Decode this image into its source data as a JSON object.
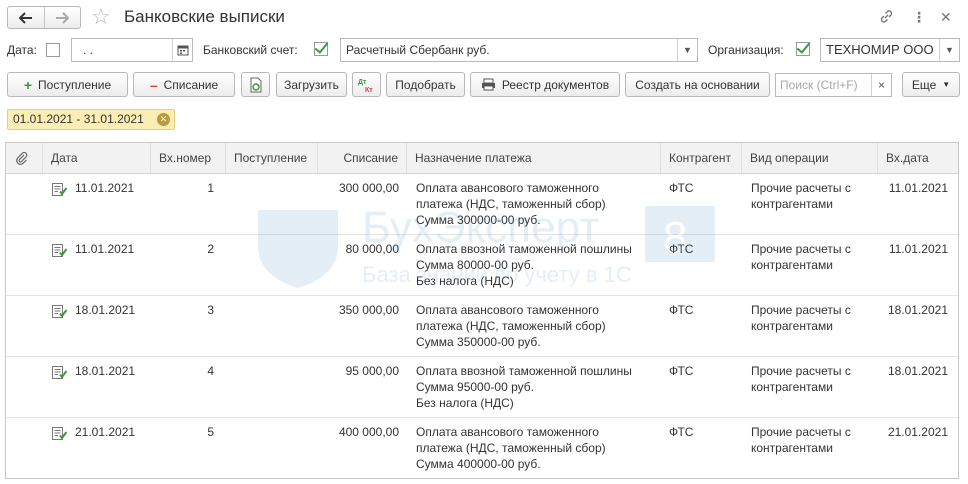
{
  "window": {
    "title": "Банковские выписки",
    "nav_back": "←",
    "nav_forward": "→",
    "favorite_icon": "star-icon",
    "link_icon": "link-icon",
    "more_icon": "more-vertical-icon",
    "close_icon": "close-icon"
  },
  "filters": {
    "date_label": "Дата:",
    "date_checked": false,
    "date_value": ". .",
    "account_label": "Банковский счет:",
    "account_checked": true,
    "account_value": "Расчетный Сбербанк руб.",
    "org_label": "Организация:",
    "org_checked": true,
    "org_value": "ТЕХНОМИР ООО"
  },
  "toolbar": {
    "income": "Поступление",
    "expense": "Списание",
    "load": "Загрузить",
    "pick": "Подобрать",
    "registry": "Реестр документов",
    "create_based": "Создать на основании",
    "search_placeholder": "Поиск (Ctrl+F)",
    "search_clear": "×",
    "more": "Еще"
  },
  "period": "01.01.2021 - 31.01.2021",
  "watermark": {
    "brand": "БухЭксперт",
    "number": "8",
    "tagline": "База знаний по учету в 1С"
  },
  "table": {
    "columns": [
      "Дата",
      "Вх.номер",
      "Поступление",
      "Списание",
      "Назначение платежа",
      "Контрагент",
      "Вид операции",
      "Вх.дата"
    ],
    "rows": [
      {
        "date": "11.01.2021",
        "in_number": "1",
        "income": "",
        "expense": "300 000,00",
        "purpose": [
          "Оплата авансового таможенного",
          "платежа (НДС, таможенный сбор)",
          "Сумма 300000-00 руб."
        ],
        "counterparty": "ФТС",
        "operation": [
          "Прочие расчеты с",
          "контрагентами"
        ],
        "in_date": "11.01.2021"
      },
      {
        "date": "11.01.2021",
        "in_number": "2",
        "income": "",
        "expense": "80 000,00",
        "purpose": [
          "Оплата ввозной таможенной пошлины",
          "Сумма 80000-00 руб.",
          "Без налога (НДС)"
        ],
        "counterparty": "ФТС",
        "operation": [
          "Прочие расчеты с",
          "контрагентами"
        ],
        "in_date": "11.01.2021"
      },
      {
        "date": "18.01.2021",
        "in_number": "3",
        "income": "",
        "expense": "350 000,00",
        "purpose": [
          "Оплата авансового таможенного",
          "платежа (НДС, таможенный сбор)",
          "Сумма 350000-00 руб."
        ],
        "counterparty": "ФТС",
        "operation": [
          "Прочие расчеты с",
          "контрагентами"
        ],
        "in_date": "18.01.2021"
      },
      {
        "date": "18.01.2021",
        "in_number": "4",
        "income": "",
        "expense": "95 000,00",
        "purpose": [
          "Оплата ввозной таможенной пошлины",
          "Сумма 95000-00 руб.",
          "Без налога (НДС)"
        ],
        "counterparty": "ФТС",
        "operation": [
          "Прочие расчеты с",
          "контрагентами"
        ],
        "in_date": "18.01.2021"
      },
      {
        "date": "21.01.2021",
        "in_number": "5",
        "income": "",
        "expense": "400 000,00",
        "purpose": [
          "Оплата авансового таможенного",
          "платежа (НДС, таможенный сбор)",
          "Сумма 400000-00 руб."
        ],
        "counterparty": "ФТС",
        "operation": [
          "Прочие расчеты с",
          "контрагентами"
        ],
        "in_date": "21.01.2021"
      }
    ]
  },
  "colors": {
    "accent_green": "#3a9a3a",
    "minus_red": "#d9423a",
    "period_bg": "#fbedb3",
    "header_bg": "#f2f2f2"
  }
}
